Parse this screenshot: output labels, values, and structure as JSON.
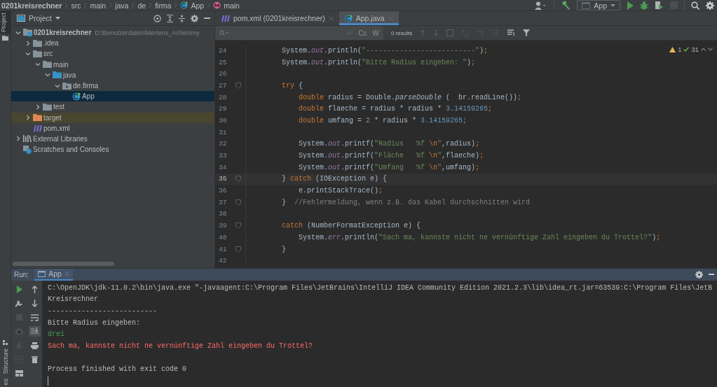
{
  "breadcrumb": [
    {
      "text": "0201kreisrechner",
      "kind": "project"
    },
    {
      "text": "src",
      "kind": "plain"
    },
    {
      "text": "main",
      "kind": "plain"
    },
    {
      "text": "java",
      "kind": "plain"
    },
    {
      "text": "de",
      "kind": "plain"
    },
    {
      "text": "firma",
      "kind": "plain"
    },
    {
      "text": "App",
      "kind": "class"
    },
    {
      "text": "main",
      "kind": "method"
    }
  ],
  "toolbar": {
    "run_config": "App"
  },
  "side_stripe": {
    "top": "Project",
    "bottom": [
      "Structure",
      "es"
    ]
  },
  "project_panel": {
    "title": "Project",
    "tree": [
      {
        "label": "0201kreisrechner",
        "location": "D:\\Benutzerdaten\\Mertens_Achim\\my",
        "kind": "module",
        "expanded": true,
        "selected": false,
        "children": [
          {
            "label": ".idea",
            "kind": "folder",
            "expanded": false,
            "selected": false
          },
          {
            "label": "src",
            "kind": "folder",
            "expanded": true,
            "selected": false,
            "children": [
              {
                "label": "main",
                "kind": "folder",
                "expanded": true,
                "selected": false,
                "children": [
                  {
                    "label": "java",
                    "kind": "source",
                    "expanded": true,
                    "selected": false,
                    "children": [
                      {
                        "label": "de.firma",
                        "kind": "package",
                        "expanded": true,
                        "selected": false,
                        "children": [
                          {
                            "label": "App",
                            "kind": "class",
                            "selected": true
                          }
                        ]
                      }
                    ]
                  }
                ]
              },
              {
                "label": "test",
                "kind": "folder",
                "expanded": false,
                "selected": false
              }
            ]
          },
          {
            "label": "target",
            "kind": "excluded",
            "expanded": false,
            "selected": false
          },
          {
            "label": "pom.xml",
            "kind": "maven",
            "selected": false
          }
        ]
      },
      {
        "label": "External Libraries",
        "kind": "libraries",
        "expanded": false,
        "selected": false
      },
      {
        "label": "Scratches and Consoles",
        "kind": "scratches",
        "selected": false
      }
    ]
  },
  "editor": {
    "tabs": [
      {
        "label": "pom.xml (0201kreisrechner)",
        "kind": "maven",
        "selected": false
      },
      {
        "label": "App.java",
        "kind": "class",
        "selected": true
      }
    ],
    "search": {
      "results": "0 results",
      "options": [
        "Cc",
        "W"
      ]
    },
    "inspections": {
      "warnings": "1",
      "checks": "31"
    },
    "lines": [
      {
        "number": "24",
        "fold": false,
        "current": false,
        "tokens": [
          {
            "text": "        System.",
            "kind": "plain"
          },
          {
            "text": "out",
            "kind": "field"
          },
          {
            "text": ".println(",
            "kind": "plain"
          },
          {
            "text": "\"--------------------------\"",
            "kind": "string"
          },
          {
            "text": ")",
            "kind": "plain"
          },
          {
            "text": ";",
            "kind": "keyword"
          }
        ]
      },
      {
        "number": "25",
        "fold": false,
        "current": false,
        "tokens": [
          {
            "text": "        System.",
            "kind": "plain"
          },
          {
            "text": "out",
            "kind": "field"
          },
          {
            "text": ".println(",
            "kind": "plain"
          },
          {
            "text": "\"Bitte Radius eingeben: \"",
            "kind": "string"
          },
          {
            "text": ")",
            "kind": "plain"
          },
          {
            "text": ";",
            "kind": "keyword"
          }
        ]
      },
      {
        "number": "26",
        "fold": false,
        "current": false
      },
      {
        "number": "27",
        "fold": true,
        "current": false,
        "tokens": [
          {
            "text": "        try",
            "kind": "keyword"
          },
          {
            "text": " {",
            "kind": "plain"
          }
        ]
      },
      {
        "number": "28",
        "fold": false,
        "current": false,
        "tokens": [
          {
            "text": "            double",
            "kind": "keyword"
          },
          {
            "text": " radius = Double.",
            "kind": "plain"
          },
          {
            "text": "parseDouble",
            "kind": "italic"
          },
          {
            "text": " (  br.readLine())",
            "kind": "plain"
          },
          {
            "text": ";",
            "kind": "keyword"
          }
        ]
      },
      {
        "number": "29",
        "fold": false,
        "current": false,
        "tokens": [
          {
            "text": "            double",
            "kind": "keyword"
          },
          {
            "text": " flaeche = radius * radius * ",
            "kind": "plain"
          },
          {
            "text": "3.14159265",
            "kind": "number"
          },
          {
            "text": ";",
            "kind": "keyword"
          }
        ]
      },
      {
        "number": "30",
        "fold": false,
        "current": false,
        "tokens": [
          {
            "text": "            double",
            "kind": "keyword"
          },
          {
            "text": " umfang = ",
            "kind": "plain"
          },
          {
            "text": "2",
            "kind": "number"
          },
          {
            "text": " * radius * ",
            "kind": "plain"
          },
          {
            "text": "3.14159265",
            "kind": "number"
          },
          {
            "text": ";",
            "kind": "keyword"
          }
        ]
      },
      {
        "number": "31",
        "fold": false,
        "current": false
      },
      {
        "number": "32",
        "fold": false,
        "current": false,
        "tokens": [
          {
            "text": "            System.",
            "kind": "plain"
          },
          {
            "text": "out",
            "kind": "field"
          },
          {
            "text": ".printf(",
            "kind": "plain"
          },
          {
            "text": "\"Radius   %f ",
            "kind": "string"
          },
          {
            "text": "\\n",
            "kind": "keyword"
          },
          {
            "text": "\"",
            "kind": "string"
          },
          {
            "text": ",radius)",
            "kind": "plain"
          },
          {
            "text": ";",
            "kind": "keyword"
          }
        ]
      },
      {
        "number": "33",
        "fold": false,
        "current": false,
        "tokens": [
          {
            "text": "            System.",
            "kind": "plain"
          },
          {
            "text": "out",
            "kind": "field"
          },
          {
            "text": ".printf(",
            "kind": "plain"
          },
          {
            "text": "\"Fläche   %f ",
            "kind": "string"
          },
          {
            "text": "\\n",
            "kind": "keyword"
          },
          {
            "text": "\"",
            "kind": "string"
          },
          {
            "text": ",flaeche)",
            "kind": "plain"
          },
          {
            "text": ";",
            "kind": "keyword"
          }
        ]
      },
      {
        "number": "34",
        "fold": false,
        "current": false,
        "tokens": [
          {
            "text": "            System.",
            "kind": "plain"
          },
          {
            "text": "out",
            "kind": "field"
          },
          {
            "text": ".printf(",
            "kind": "plain"
          },
          {
            "text": "\"Umfang   %f ",
            "kind": "string"
          },
          {
            "text": "\\n",
            "kind": "keyword"
          },
          {
            "text": "\"",
            "kind": "string"
          },
          {
            "text": ",umfang)",
            "kind": "plain"
          },
          {
            "text": ";",
            "kind": "keyword"
          }
        ]
      },
      {
        "number": "35",
        "fold": true,
        "current": true,
        "tokens": [
          {
            "text": "        } ",
            "kind": "plain"
          },
          {
            "text": "catch",
            "kind": "keyword"
          },
          {
            "text": " (IOException e) {",
            "kind": "plain"
          }
        ]
      },
      {
        "number": "36",
        "fold": false,
        "current": false,
        "tokens": [
          {
            "text": "            e.printStackTrace()",
            "kind": "plain"
          },
          {
            "text": ";",
            "kind": "keyword"
          }
        ]
      },
      {
        "number": "37",
        "fold": true,
        "current": false,
        "tokens": [
          {
            "text": "        }  ",
            "kind": "plain"
          },
          {
            "text": "//Fehlermeldung, wenn z.B. das Kabel durchschnitten wird",
            "kind": "comment"
          }
        ]
      },
      {
        "number": "38",
        "fold": false,
        "current": false
      },
      {
        "number": "39",
        "fold": true,
        "current": false,
        "tokens": [
          {
            "text": "        catch",
            "kind": "keyword"
          },
          {
            "text": " (NumberFormatException e) {",
            "kind": "plain"
          }
        ]
      },
      {
        "number": "40",
        "fold": false,
        "current": false,
        "tokens": [
          {
            "text": "            System.",
            "kind": "plain"
          },
          {
            "text": "err",
            "kind": "field"
          },
          {
            "text": ".println(",
            "kind": "plain"
          },
          {
            "text": "\"Sach ma, kannste nicht ne vernünftige Zahl eingeben du Trottel?\"",
            "kind": "string"
          },
          {
            "text": ")",
            "kind": "plain"
          },
          {
            "text": ";",
            "kind": "keyword"
          }
        ]
      },
      {
        "number": "41",
        "fold": true,
        "current": false,
        "tokens": [
          {
            "text": "        }",
            "kind": "plain"
          }
        ]
      },
      {
        "number": "42",
        "fold": false,
        "current": false
      }
    ]
  },
  "run_panel": {
    "label": "Run:",
    "tabs": [
      {
        "label": "App",
        "selected": true
      }
    ],
    "console": [
      {
        "text": "C:\\OpenJDK\\jdk-11.0.2\\bin\\java.exe \"-javaagent:C:\\Program Files\\JetBrains\\IntelliJ IDEA Community Edition 2021.2.3\\lib\\idea_rt.jar=63539:C:\\Program Files\\JetB",
        "kind": "output"
      },
      {
        "text": "Kreisrechner",
        "kind": "output"
      },
      {
        "text": "--------------------------",
        "kind": "output"
      },
      {
        "text": "Bitte Radius eingeben:",
        "kind": "output"
      },
      {
        "text": "drei",
        "kind": "input"
      },
      {
        "text": "Sach ma, kannste nicht ne vernünftige Zahl eingeben du Trottel?",
        "kind": "error"
      },
      {
        "kind": "blank"
      },
      {
        "text": "Process finished with exit code 0",
        "kind": "output"
      }
    ]
  }
}
